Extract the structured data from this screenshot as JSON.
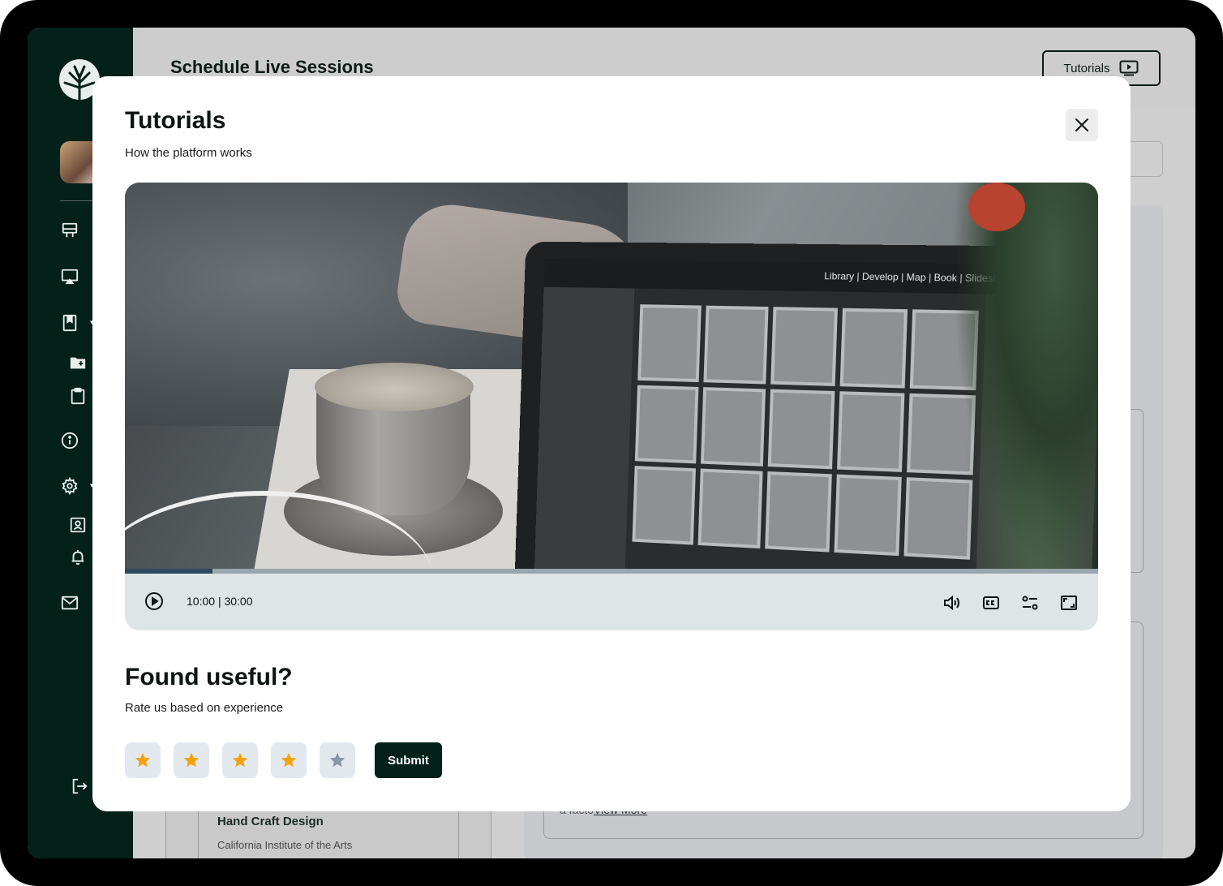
{
  "background": {
    "page_title": "Schedule Live Sessions",
    "tutorials_button_label": "Tutorials",
    "card_title": "Hand Craft Design",
    "card_subtitle": "California Institute of the Arts",
    "card_text_prefix": "a facto",
    "view_more_label": "View More"
  },
  "sidebar": {
    "items": [
      {
        "icon": "dashboard-icon"
      },
      {
        "icon": "screen-share-icon"
      },
      {
        "icon": "bookmark-icon",
        "has_submenu": true
      },
      {
        "icon": "folder-add-icon"
      },
      {
        "icon": "clipboard-icon"
      },
      {
        "icon": "info-icon"
      },
      {
        "icon": "gear-icon",
        "has_submenu": true
      },
      {
        "icon": "profile-card-icon"
      },
      {
        "icon": "bell-icon"
      },
      {
        "icon": "mail-icon"
      },
      {
        "icon": "logout-icon"
      }
    ]
  },
  "modal": {
    "title": "Tutorials",
    "subtitle": "How the platform works",
    "video": {
      "current_time": "10:00",
      "separator": "|",
      "duration": "30:00",
      "progress": 0.09,
      "screen_menu": "Library | Develop | Map | Book | Slideshow | Print | Web"
    },
    "rating": {
      "title": "Found useful?",
      "subtitle": "Rate us based on experience",
      "stars_total": 5,
      "stars_selected": 4,
      "submit_label": "Submit"
    }
  },
  "colors": {
    "sidebar_bg": "#032019",
    "star_active": "#F5A20A",
    "star_inactive": "#8A94A6",
    "submit_bg": "#032019"
  }
}
